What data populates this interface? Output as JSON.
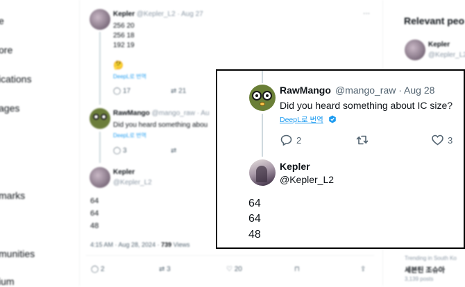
{
  "background": {
    "sidebar_nav": [
      "e",
      "ore",
      "ications",
      "ages",
      "marks",
      "munities",
      "ium"
    ],
    "right_title": "Relevant peo",
    "right_user": {
      "name": "Kepler",
      "handle": "@Kepler_L2"
    },
    "trend": {
      "label": "Trending in South Ko",
      "title": "세븐틴 조슈아",
      "count": "3,139 posts"
    },
    "tweet1": {
      "name": "Kepler",
      "handle": "@Kepler_L2",
      "date": "· Aug 27",
      "lines": [
        "256 20",
        "256 18",
        "192 19"
      ],
      "emoji": "🤔",
      "translate": "DeepL로 번역",
      "replies": "17",
      "retweets": "21"
    },
    "tweet2": {
      "name": "RawMango",
      "handle": "@mango_raw · Au",
      "text": "Did you heard something abou",
      "translate": "DeepL로 번역",
      "replies": "3"
    },
    "tweet3": {
      "name": "Kepler",
      "handle": "@Kepler_L2",
      "lines": [
        "64",
        "64",
        "48"
      ],
      "meta_time": "4:15 AM · Aug 28, 2024 · ",
      "views_count": "739",
      "views_label": " Views"
    },
    "bottom_actions": {
      "replies": "2",
      "retweets": "3",
      "likes": "20"
    },
    "more_dots": "···"
  },
  "popup": {
    "reply": {
      "name": "RawMango",
      "handle": "@mango_raw · Aug 28",
      "text": "Did you heard something about IC size?",
      "translate": "DeepL로 번역",
      "replies": "2",
      "likes": "3"
    },
    "main": {
      "name": "Kepler",
      "handle": "@Kepler_L2",
      "lines": [
        "64",
        "64",
        "48"
      ]
    }
  },
  "colors": {
    "accent": "#1d9bf0",
    "muted": "#536471",
    "text": "#0f1419",
    "thread_line": "#cfd9de",
    "popup_border": "#000000"
  }
}
